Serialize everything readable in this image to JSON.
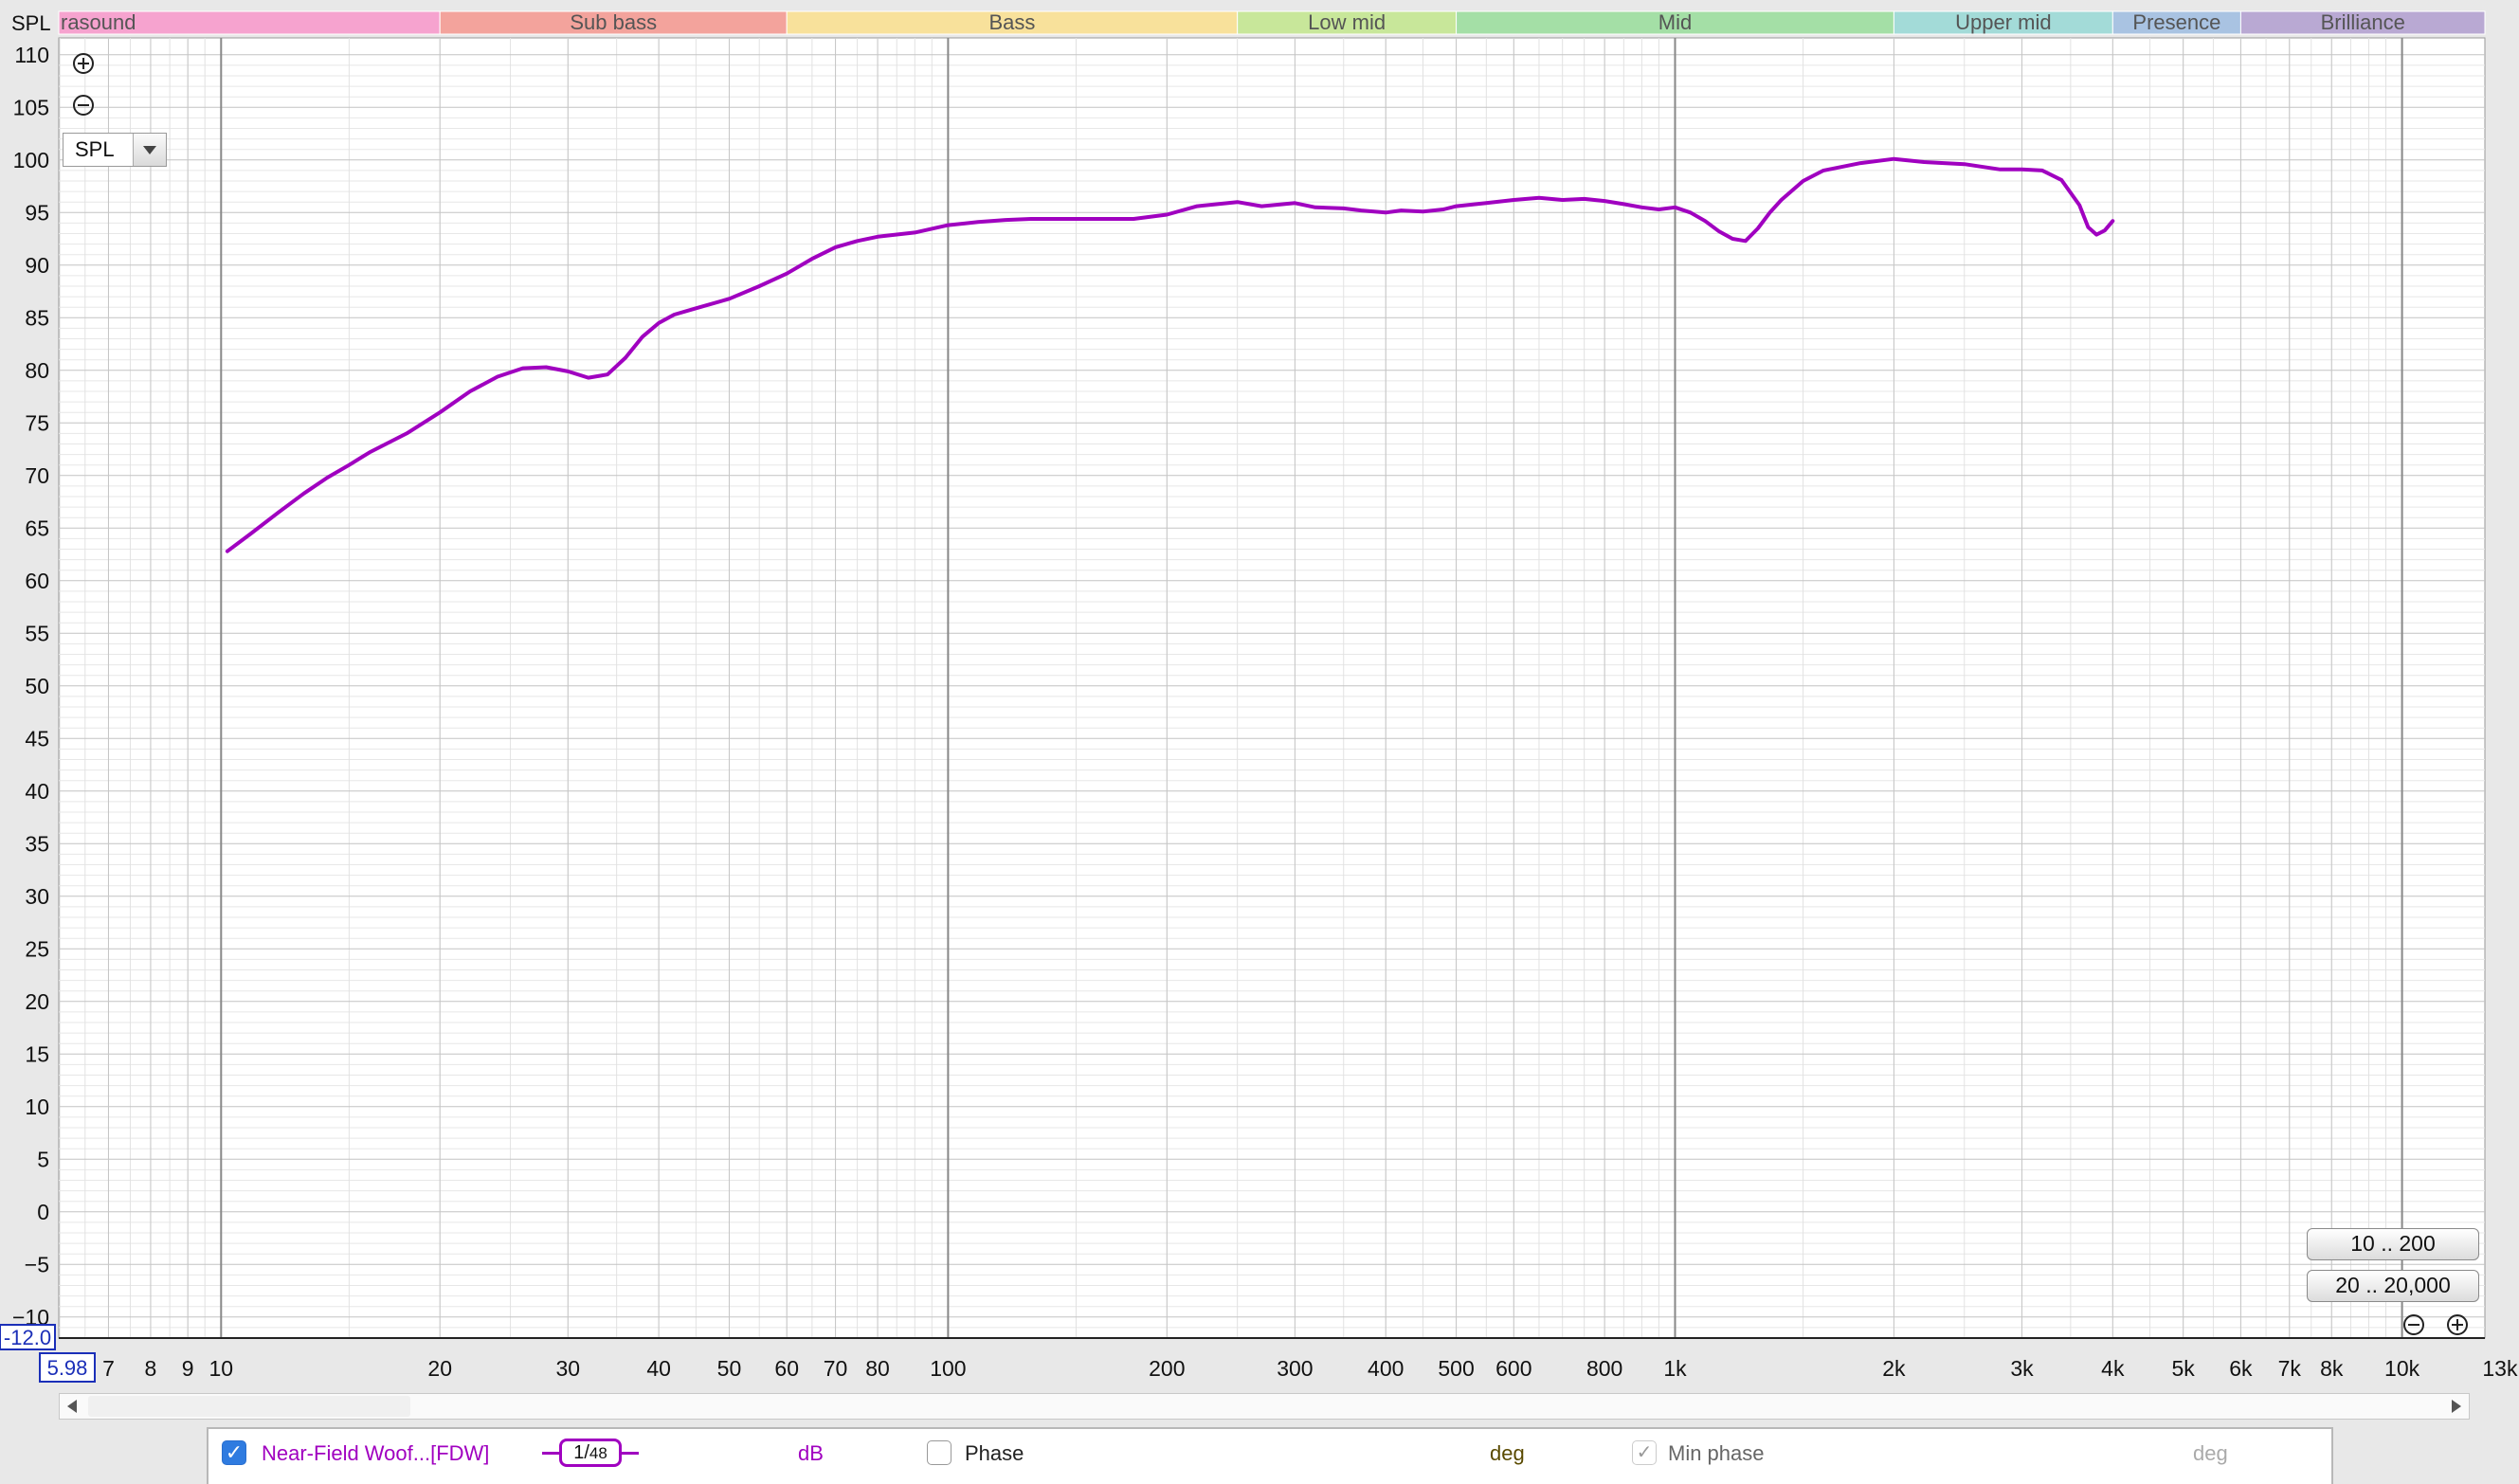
{
  "chart_data": {
    "type": "line",
    "ylabel": "SPL",
    "xunit": "kHz",
    "x_scale": "log",
    "xlim": [
      5.98,
      13000
    ],
    "ylim": [
      -12.0,
      110
    ],
    "x_min_field": "5.98",
    "y_min_field": "-12.0",
    "y_ticks": [
      "110",
      "105",
      "100",
      "95",
      "90",
      "85",
      "80",
      "75",
      "70",
      "65",
      "60",
      "55",
      "50",
      "45",
      "40",
      "35",
      "30",
      "25",
      "20",
      "15",
      "10",
      "5",
      "0",
      "−5",
      "−10"
    ],
    "y_tick_values": [
      110,
      105,
      100,
      95,
      90,
      85,
      80,
      75,
      70,
      65,
      60,
      55,
      50,
      45,
      40,
      35,
      30,
      25,
      20,
      15,
      10,
      5,
      0,
      -5,
      -10
    ],
    "x_ticks": [
      {
        "value": 7,
        "label": "7"
      },
      {
        "value": 8,
        "label": "8"
      },
      {
        "value": 9,
        "label": "9"
      },
      {
        "value": 10,
        "label": "10"
      },
      {
        "value": 20,
        "label": "20"
      },
      {
        "value": 30,
        "label": "30"
      },
      {
        "value": 40,
        "label": "40"
      },
      {
        "value": 50,
        "label": "50"
      },
      {
        "value": 60,
        "label": "60"
      },
      {
        "value": 70,
        "label": "70"
      },
      {
        "value": 80,
        "label": "80"
      },
      {
        "value": 100,
        "label": "100"
      },
      {
        "value": 200,
        "label": "200"
      },
      {
        "value": 300,
        "label": "300"
      },
      {
        "value": 400,
        "label": "400"
      },
      {
        "value": 500,
        "label": "500"
      },
      {
        "value": 600,
        "label": "600"
      },
      {
        "value": 800,
        "label": "800"
      },
      {
        "value": 1000,
        "label": "1k"
      },
      {
        "value": 2000,
        "label": "2k"
      },
      {
        "value": 3000,
        "label": "3k"
      },
      {
        "value": 4000,
        "label": "4k"
      },
      {
        "value": 5000,
        "label": "5k"
      },
      {
        "value": 6000,
        "label": "6k"
      },
      {
        "value": 7000,
        "label": "7k"
      },
      {
        "value": 8000,
        "label": "8k"
      },
      {
        "value": 10000,
        "label": "10k"
      },
      {
        "value": 13000,
        "label": "13kHz"
      }
    ],
    "bands": [
      {
        "label": "rasound",
        "from": 5.98,
        "to": 20,
        "color": "#f6a3cf"
      },
      {
        "label": "Sub bass",
        "from": 20,
        "to": 60,
        "color": "#f3a39c"
      },
      {
        "label": "Bass",
        "from": 60,
        "to": 250,
        "color": "#f8e19b"
      },
      {
        "label": "Low mid",
        "from": 250,
        "to": 500,
        "color": "#c8e79a"
      },
      {
        "label": "Mid",
        "from": 500,
        "to": 2000,
        "color": "#a4dfa6"
      },
      {
        "label": "Upper mid",
        "from": 2000,
        "to": 4000,
        "color": "#a3dbd8"
      },
      {
        "label": "Presence",
        "from": 4000,
        "to": 6000,
        "color": "#a9c3e2"
      },
      {
        "label": "Brilliance",
        "from": 6000,
        "to": 13000,
        "color": "#b9a9d3"
      }
    ],
    "series": [
      {
        "name": "Near-Field Woof...[FDW]",
        "color": "#a000c0",
        "x": [
          10.2,
          11,
          12,
          13,
          14,
          15,
          16,
          18,
          20,
          22,
          24,
          26,
          28,
          30,
          32,
          34,
          36,
          38,
          40,
          42,
          45,
          50,
          55,
          60,
          65,
          70,
          75,
          80,
          90,
          100,
          110,
          120,
          130,
          150,
          170,
          180,
          200,
          220,
          250,
          270,
          300,
          320,
          350,
          370,
          400,
          420,
          450,
          480,
          500,
          550,
          600,
          650,
          700,
          750,
          800,
          850,
          900,
          950,
          1000,
          1050,
          1100,
          1150,
          1200,
          1250,
          1300,
          1350,
          1400,
          1500,
          1600,
          1800,
          2000,
          2200,
          2500,
          2800,
          3000,
          3200,
          3400,
          3600,
          3700,
          3800,
          3900,
          4000
        ],
        "y": [
          62.8,
          64.5,
          66.5,
          68.3,
          69.8,
          71,
          72.2,
          74,
          76,
          78,
          79.4,
          80.2,
          80.3,
          79.9,
          79.3,
          79.6,
          81.2,
          83.2,
          84.5,
          85.3,
          85.9,
          86.8,
          88,
          89.2,
          90.6,
          91.7,
          92.3,
          92.7,
          93.1,
          93.8,
          94.1,
          94.3,
          94.4,
          94.4,
          94.4,
          94.4,
          94.8,
          95.6,
          96,
          95.6,
          95.9,
          95.5,
          95.4,
          95.2,
          95,
          95.2,
          95.1,
          95.3,
          95.6,
          95.9,
          96.2,
          96.4,
          96.2,
          96.3,
          96.1,
          95.8,
          95.5,
          95.3,
          95.5,
          95,
          94.2,
          93.2,
          92.5,
          92.3,
          93.5,
          95,
          96.2,
          98,
          99,
          99.7,
          100.1,
          99.8,
          99.6,
          99.1,
          99.1,
          99,
          98.1,
          95.7,
          93.6,
          92.9,
          93.3,
          94.2
        ]
      }
    ]
  },
  "controls": {
    "measure_selected": "SPL",
    "range_button_1": "10 .. 200",
    "range_button_2": "20 .. 20,000",
    "icons": [
      "zoom-in-icon",
      "zoom-out-icon",
      "chevron-down-icon",
      "scroll-left-icon",
      "scroll-right-icon",
      "checkmark-icon"
    ]
  },
  "legend": {
    "trace_checked": true,
    "trace_name": "Near-Field Woof...[FDW]",
    "smoothing_num": "1",
    "smoothing_den": "48",
    "unit_db": "dB",
    "phase_label": "Phase",
    "phase_checked": false,
    "unit_deg": "deg",
    "min_phase_label": "Min phase",
    "min_phase_checked": true,
    "unit_deg_2": "deg"
  },
  "colors": {
    "trace": "#a000c0",
    "plot_background": "#ffffff",
    "axis_field_border": "#1b2fb8"
  }
}
